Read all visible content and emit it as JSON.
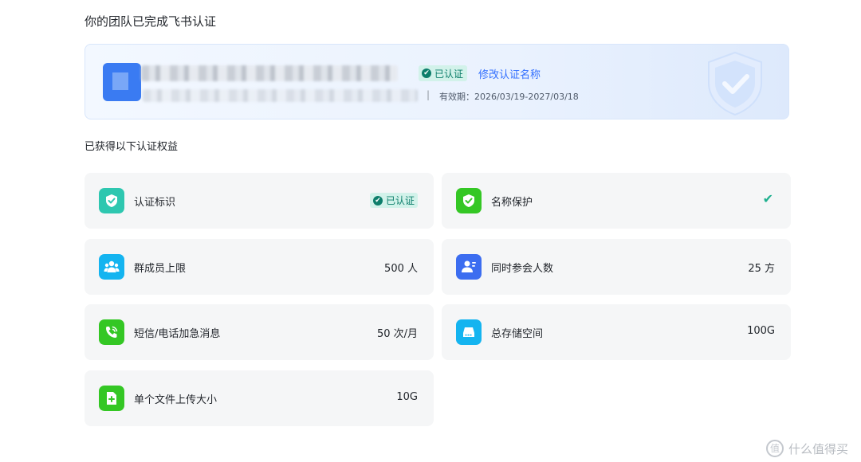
{
  "page": {
    "title": "你的团队已完成飞书认证"
  },
  "banner": {
    "verified_label": "已认证",
    "rename_link": "修改认证名称",
    "separator": "|",
    "validity": "有效期：2026/03/19-2027/03/18"
  },
  "benefits": {
    "title": "已获得以下认证权益",
    "items": [
      {
        "label": "认证标识",
        "value": "已认证",
        "icon": "shield-check-icon",
        "color": "#2ec7b0"
      },
      {
        "label": "名称保护",
        "value": "✔",
        "icon": "shield-check-icon",
        "color": "#34c724"
      },
      {
        "label": "群成员上限",
        "value": "500 人",
        "icon": "group-icon",
        "color": "#14b4f0"
      },
      {
        "label": "同时参会人数",
        "value": "25 方",
        "icon": "meeting-user-icon",
        "color": "#3c6df0"
      },
      {
        "label": "短信/电话加急消息",
        "value": "50 次/月",
        "icon": "phone-icon",
        "color": "#34c724"
      },
      {
        "label": "总存储空间",
        "value": "100G",
        "icon": "storage-icon",
        "color": "#14b4f0"
      },
      {
        "label": "单个文件上传大小",
        "value": "10G",
        "icon": "file-upload-icon",
        "color": "#34c724"
      }
    ]
  },
  "watermark": {
    "text": "什么值得买",
    "badge": "值"
  }
}
